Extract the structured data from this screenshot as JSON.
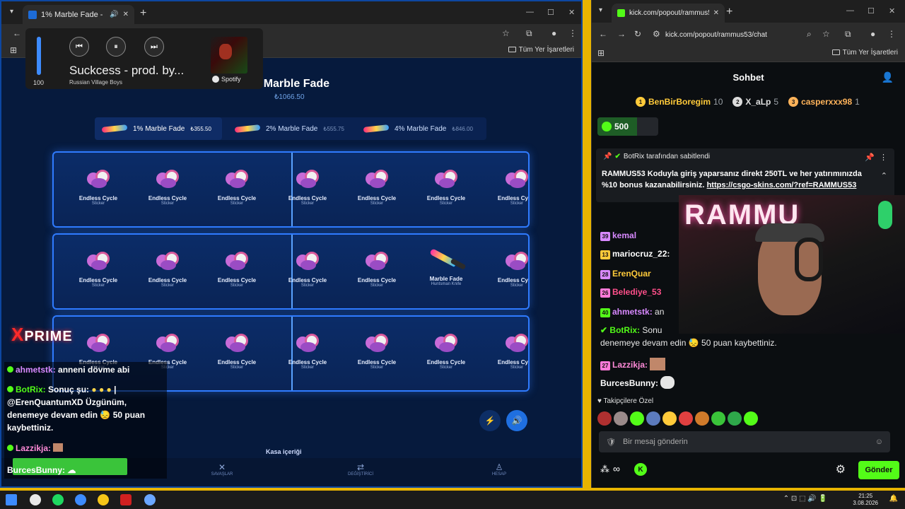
{
  "left_browser": {
    "tab_title": "1% Marble Fade - CSGO-Sk",
    "bookmarks_label": "Tüm Yer İşaretleri"
  },
  "media_player": {
    "volume": 100,
    "volume_label": "100",
    "song": "Suckcess - prod. by...",
    "artist": "Russian Village Boys",
    "brand": "Spotify"
  },
  "case": {
    "title": "Marble Fade",
    "title_prefix": "1%",
    "price": "₺1066.50",
    "variants": [
      {
        "name": "1% Marble Fade",
        "price": "₺355.50"
      },
      {
        "name": "2% Marble Fade",
        "price": "₺555.75"
      },
      {
        "name": "4% Marble Fade",
        "price": "₺846.00"
      }
    ],
    "sticker_name": "Endless Cycle",
    "sticker_type": "Sticker",
    "knife_name": "Marble Fade",
    "knife_type": "Huntsman Knife",
    "contents_label": "Kasa içeriği",
    "nav": [
      "SAVAŞLAR",
      "DEĞİŞTİRİCİ",
      "HESAP"
    ]
  },
  "stream_overlay": {
    "logo": "PRIME",
    "messages": [
      {
        "user": "ahmetstk:",
        "text": "anneni dövme abi"
      },
      {
        "user": "BotRix:",
        "text": "Sonuç şu:"
      },
      {
        "user": "",
        "text": "@ErenQuantumXD Üzgünüm,"
      },
      {
        "user": "",
        "text": "denemeye devam edin"
      },
      {
        "user": "",
        "text": "50 puan"
      },
      {
        "user": "",
        "text": "kaybettiniz."
      },
      {
        "user": "Lazzikja:",
        "text": ""
      },
      {
        "user": "BurcesBunny:",
        "text": ""
      }
    ]
  },
  "right_browser": {
    "tab_title": "kick.com/popout/rammus53/ch",
    "url": "kick.com/popout/rammus53/chat",
    "bookmarks_label": "Tüm Yer İşaretleri"
  },
  "chat": {
    "title": "Sohbet",
    "gifters": [
      {
        "rank": "1",
        "name": "BenBirBoregim",
        "count": "10"
      },
      {
        "rank": "2",
        "name": "X_aLp",
        "count": "5"
      },
      {
        "rank": "3",
        "name": "casperxxx98",
        "count": "1"
      }
    ],
    "points": "500",
    "pinned_header": "BotRix tarafından sabitlendi",
    "pinned_text": "RAMMUS53 Koduyla giriş yaparsanız direkt 250TL ve her yatırımınızda %10 bonus kazanabilirsiniz.",
    "pinned_link": "https://csgo-skins.com/?ref=RAMMUS53",
    "messages": [
      {
        "badge": "39",
        "user": "kemal",
        "text": ""
      },
      {
        "badge": "13",
        "user": "mariocruz_22:",
        "text": ""
      },
      {
        "badge": "28",
        "user": "ErenQuar",
        "text": ""
      },
      {
        "badge": "26",
        "user": "Belediye_53",
        "text": ""
      },
      {
        "badge": "40",
        "user": "ahmetstk:",
        "text": "an"
      },
      {
        "badge": "",
        "user": "BotRix:",
        "text": "Sonu"
      },
      {
        "badge": "",
        "user": "",
        "text": "denemeye devam edin 😓 50 puan kaybettiniz."
      },
      {
        "badge": "27",
        "user": "Lazzikja:",
        "text": ""
      },
      {
        "badge": "",
        "user": "BurcesBunny:",
        "text": ""
      }
    ],
    "subs_label": "Takipçilere Özel",
    "input_placeholder": "Bir mesaj gönderin",
    "send_label": "Gönder"
  },
  "taskbar": {
    "time": "21:25",
    "date": "3.08.2026"
  },
  "colors": {
    "kick_green": "#53fc18",
    "site_bg": "#061a3d",
    "reel_border": "#2f7bff"
  }
}
